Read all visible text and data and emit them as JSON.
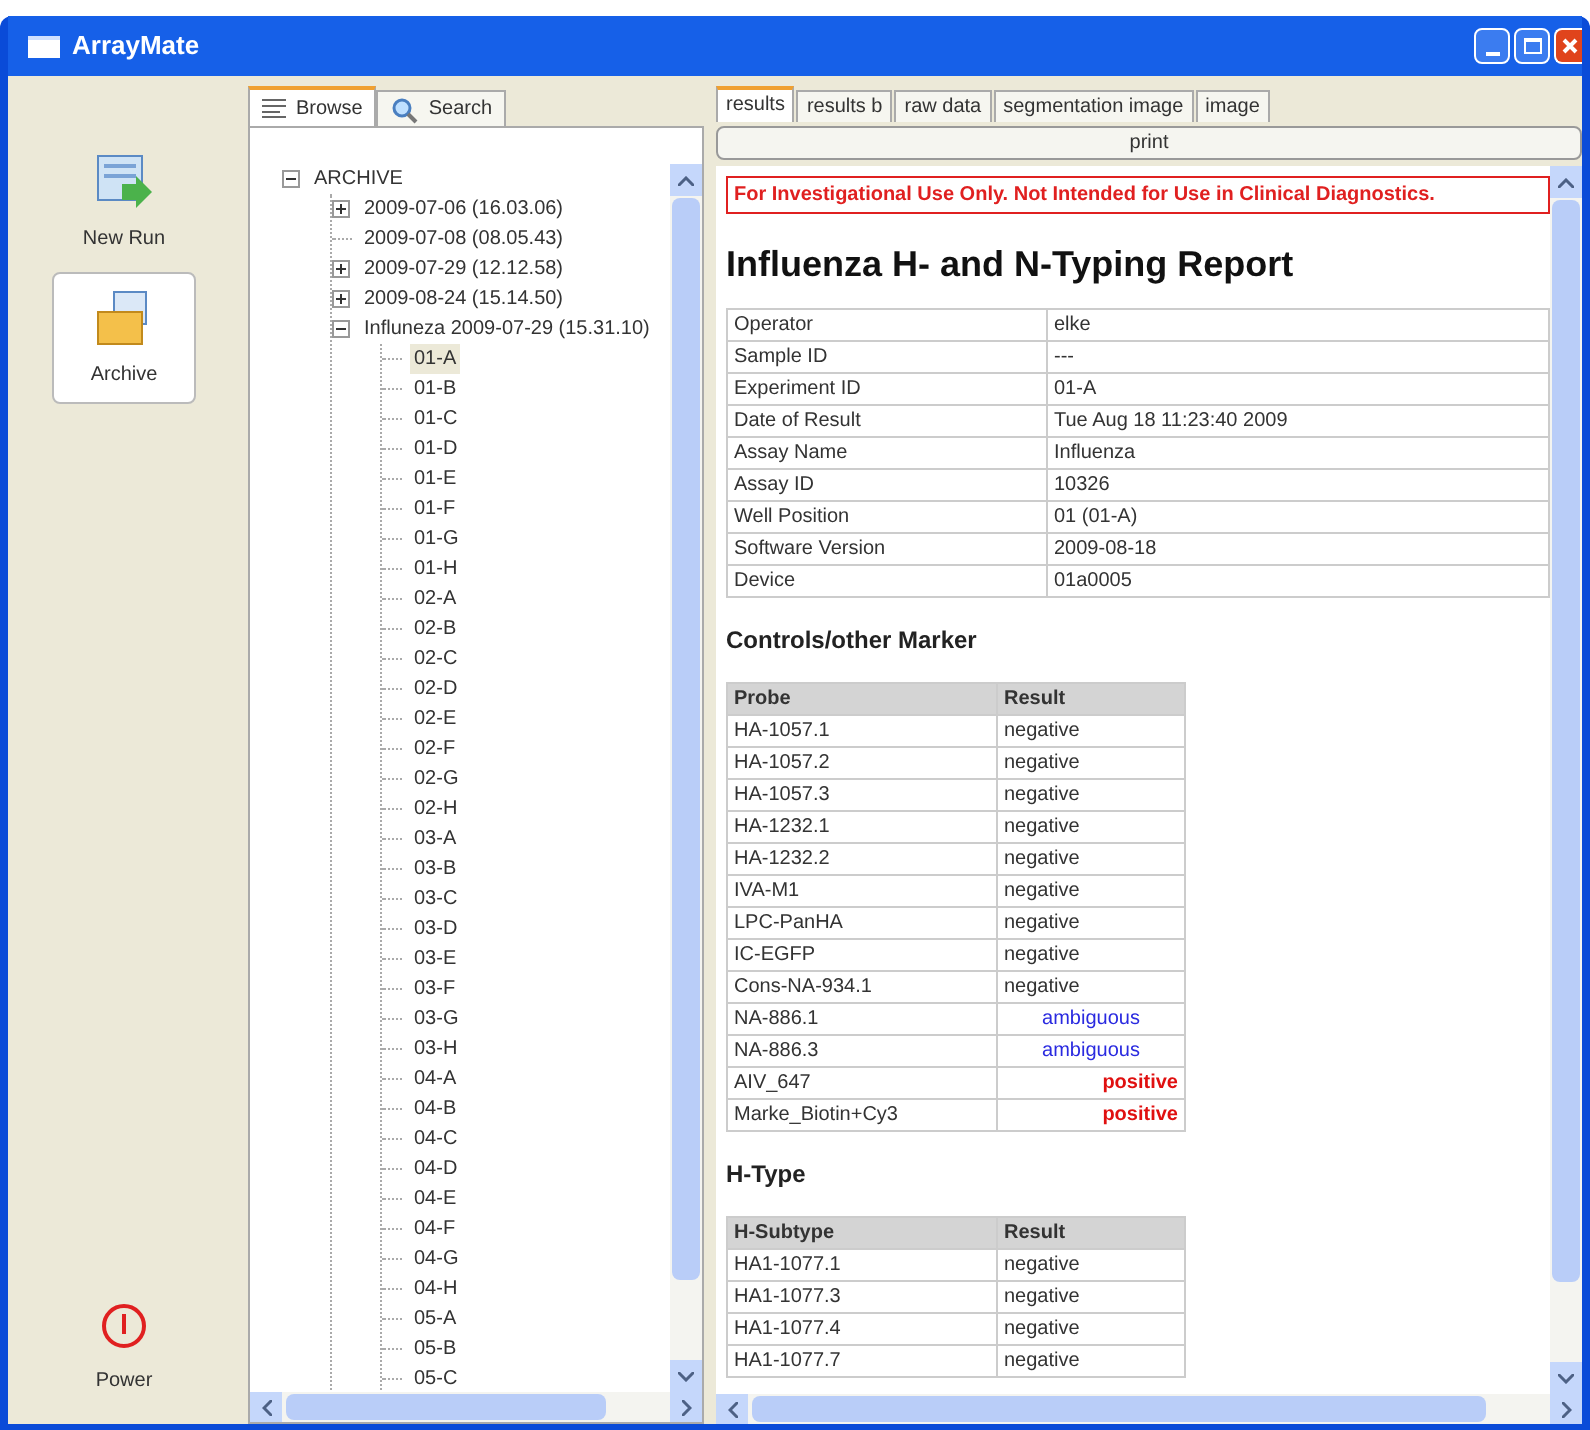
{
  "window": {
    "title": "ArrayMate"
  },
  "toolbar": [
    {
      "label": "New Run",
      "kind": "newrun",
      "selected": false
    },
    {
      "label": "Archive",
      "kind": "archive",
      "selected": true
    }
  ],
  "power": {
    "label": "Power"
  },
  "browser_tabs": [
    {
      "label": "Browse",
      "kind": "browse",
      "selected": true
    },
    {
      "label": "Search",
      "kind": "search",
      "selected": false
    }
  ],
  "tree": [
    {
      "label": "ARCHIVE",
      "expanded": true,
      "selected": false,
      "children": [
        {
          "label": "2009-07-06 (16.03.06)",
          "expanded": false,
          "selected": false
        },
        {
          "label": "2009-07-08 (08.05.43)",
          "selected": false
        },
        {
          "label": "2009-07-29 (12.12.58)",
          "expanded": false,
          "selected": false
        },
        {
          "label": "2009-08-24 (15.14.50)",
          "expanded": false,
          "selected": false
        },
        {
          "label": "Influneza 2009-07-29 (15.31.10)",
          "expanded": true,
          "selected": false,
          "children": [
            {
              "label": "01-A",
              "selected": true
            },
            {
              "label": "01-B",
              "selected": false
            },
            {
              "label": "01-C",
              "selected": false
            },
            {
              "label": "01-D",
              "selected": false
            },
            {
              "label": "01-E",
              "selected": false
            },
            {
              "label": "01-F",
              "selected": false
            },
            {
              "label": "01-G",
              "selected": false
            },
            {
              "label": "01-H",
              "selected": false
            },
            {
              "label": "02-A",
              "selected": false
            },
            {
              "label": "02-B",
              "selected": false
            },
            {
              "label": "02-C",
              "selected": false
            },
            {
              "label": "02-D",
              "selected": false
            },
            {
              "label": "02-E",
              "selected": false
            },
            {
              "label": "02-F",
              "selected": false
            },
            {
              "label": "02-G",
              "selected": false
            },
            {
              "label": "02-H",
              "selected": false
            },
            {
              "label": "03-A",
              "selected": false
            },
            {
              "label": "03-B",
              "selected": false
            },
            {
              "label": "03-C",
              "selected": false
            },
            {
              "label": "03-D",
              "selected": false
            },
            {
              "label": "03-E",
              "selected": false
            },
            {
              "label": "03-F",
              "selected": false
            },
            {
              "label": "03-G",
              "selected": false
            },
            {
              "label": "03-H",
              "selected": false
            },
            {
              "label": "04-A",
              "selected": false
            },
            {
              "label": "04-B",
              "selected": false
            },
            {
              "label": "04-C",
              "selected": false
            },
            {
              "label": "04-D",
              "selected": false
            },
            {
              "label": "04-E",
              "selected": false
            },
            {
              "label": "04-F",
              "selected": false
            },
            {
              "label": "04-G",
              "selected": false
            },
            {
              "label": "04-H",
              "selected": false
            },
            {
              "label": "05-A",
              "selected": false
            },
            {
              "label": "05-B",
              "selected": false
            },
            {
              "label": "05-C",
              "selected": false
            }
          ]
        }
      ]
    }
  ],
  "report_tabs": [
    {
      "label": "results",
      "selected": true
    },
    {
      "label": "results b",
      "selected": false
    },
    {
      "label": "raw data",
      "selected": false
    },
    {
      "label": "segmentation image",
      "selected": false
    },
    {
      "label": "image",
      "selected": false
    }
  ],
  "print_button": "print",
  "warning": "For Investigational Use Only. Not Intended for  Use in Clinical Diagnostics.",
  "report_title": "Influenza H- and N-Typing Report",
  "info": [
    {
      "label": "Operator",
      "value": "elke"
    },
    {
      "label": "Sample ID",
      "value": "---"
    },
    {
      "label": "Experiment ID",
      "value": "01-A"
    },
    {
      "label": "Date of Result",
      "value": "Tue Aug 18 11:23:40 2009"
    },
    {
      "label": "Assay Name",
      "value": "Influenza"
    },
    {
      "label": "Assay ID",
      "value": "10326"
    },
    {
      "label": "Well Position",
      "value": "01 (01-A)"
    },
    {
      "label": "Software Version",
      "value": "2009-08-18"
    },
    {
      "label": "Device",
      "value": "01a0005"
    }
  ],
  "sections": [
    {
      "heading": "Controls/other Marker",
      "columns": [
        "Probe",
        "Result"
      ],
      "rows": [
        {
          "name": "HA-1057.1",
          "result": "negative",
          "kind": "negative"
        },
        {
          "name": "HA-1057.2",
          "result": "negative",
          "kind": "negative"
        },
        {
          "name": "HA-1057.3",
          "result": "negative",
          "kind": "negative"
        },
        {
          "name": "HA-1232.1",
          "result": "negative",
          "kind": "negative"
        },
        {
          "name": "HA-1232.2",
          "result": "negative",
          "kind": "negative"
        },
        {
          "name": "IVA-M1",
          "result": "negative",
          "kind": "negative"
        },
        {
          "name": "LPC-PanHA",
          "result": "negative",
          "kind": "negative"
        },
        {
          "name": "IC-EGFP",
          "result": "negative",
          "kind": "negative"
        },
        {
          "name": "Cons-NA-934.1",
          "result": "negative",
          "kind": "negative"
        },
        {
          "name": "NA-886.1",
          "result": "ambiguous",
          "kind": "ambiguous"
        },
        {
          "name": "NA-886.3",
          "result": "ambiguous",
          "kind": "ambiguous"
        },
        {
          "name": "AIV_647",
          "result": "positive",
          "kind": "positive"
        },
        {
          "name": "Marke_Biotin+Cy3",
          "result": "positive",
          "kind": "positive"
        }
      ]
    },
    {
      "heading": "H-Type",
      "columns": [
        "H-Subtype",
        "Result"
      ],
      "rows": [
        {
          "name": "HA1-1077.1",
          "result": "negative",
          "kind": "negative"
        },
        {
          "name": "HA1-1077.3",
          "result": "negative",
          "kind": "negative"
        },
        {
          "name": "HA1-1077.4",
          "result": "negative",
          "kind": "negative"
        },
        {
          "name": "HA1-1077.7",
          "result": "negative",
          "kind": "negative"
        }
      ]
    }
  ]
}
